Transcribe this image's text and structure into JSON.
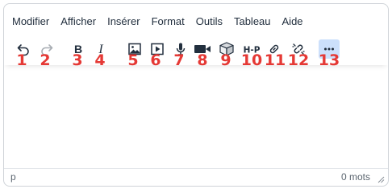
{
  "menubar": {
    "items": [
      "Modifier",
      "Afficher",
      "Insérer",
      "Format",
      "Outils",
      "Tableau",
      "Aide"
    ]
  },
  "toolbar": {
    "buttons": [
      {
        "icon": "undo-icon",
        "badge": "1"
      },
      {
        "icon": "redo-icon",
        "badge": "2"
      },
      {
        "icon": "bold-icon",
        "badge": "3"
      },
      {
        "icon": "italic-icon",
        "badge": "4"
      },
      {
        "icon": "image-icon",
        "badge": "5"
      },
      {
        "icon": "media-icon",
        "badge": "6"
      },
      {
        "icon": "microphone-icon",
        "badge": "7"
      },
      {
        "icon": "video-camera-icon",
        "badge": "8"
      },
      {
        "icon": "package-icon",
        "badge": "9"
      },
      {
        "icon": "h5p-icon",
        "badge": "10"
      },
      {
        "icon": "link-icon",
        "badge": "11"
      },
      {
        "icon": "unlink-icon",
        "badge": "12"
      },
      {
        "icon": "more-icon",
        "badge": "13"
      }
    ]
  },
  "statusbar": {
    "path": "p",
    "word_count": "0 mots"
  },
  "colors": {
    "badge": "#e53935",
    "active_button": "#cce0fb",
    "icon": "#222f3e"
  }
}
